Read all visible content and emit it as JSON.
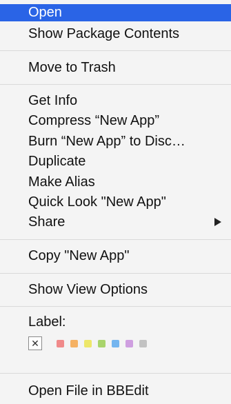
{
  "menu": {
    "items": [
      {
        "label": "Open"
      },
      {
        "label": "Show Package Contents"
      },
      {
        "label": "Move to Trash"
      },
      {
        "label": "Get Info"
      },
      {
        "label": "Compress “New App”"
      },
      {
        "label": "Burn “New App” to Disc…"
      },
      {
        "label": "Duplicate"
      },
      {
        "label": "Make Alias"
      },
      {
        "label": "Quick Look \"New App\""
      },
      {
        "label": "Share"
      },
      {
        "label": "Copy \"New App\""
      },
      {
        "label": "Show View Options"
      },
      {
        "label": "Open File in BBEdit"
      }
    ],
    "label_section": {
      "title": "Label:",
      "none_glyph": "✕",
      "colors": [
        "#f08a8a",
        "#f5b163",
        "#ede76a",
        "#a9d46c",
        "#74b5ef",
        "#cf9fe0",
        "#c2c2c2"
      ]
    },
    "highlight_color": "#2a64e6",
    "submenu_arrow_icon": "chevron-right-icon"
  }
}
